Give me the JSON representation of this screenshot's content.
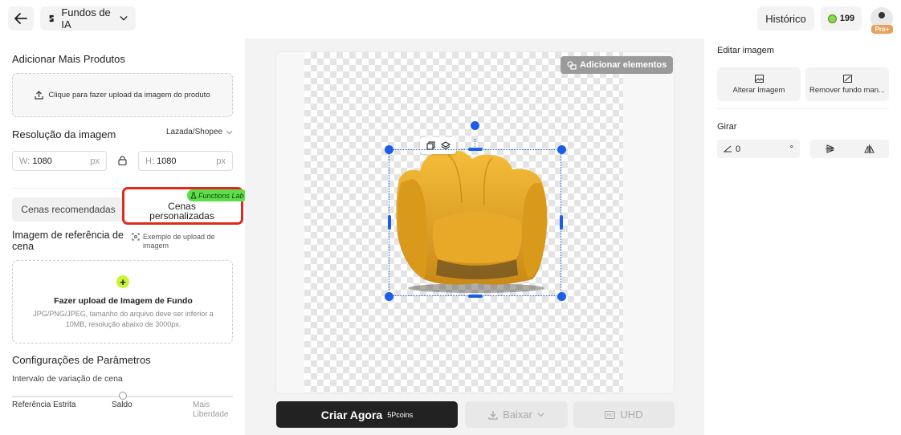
{
  "header": {
    "tool_label": "Fundos de IA",
    "history_label": "Histórico",
    "coins": "199",
    "pro_badge": "Pro+"
  },
  "left": {
    "add_products_title": "Adicionar Mais Produtos",
    "upload_product_label": "Clique para fazer upload da imagem do produto",
    "resolution_title": "Resolução da imagem",
    "resolution_preset": "Lazada/Shopee",
    "width_label": "W:",
    "width_value": "1080",
    "height_label": "H:",
    "height_value": "1080",
    "unit": "px",
    "tab_recommended": "Cenas recomendadas",
    "tab_custom": "Cenas personalizadas",
    "lab_badge": "Functions Lab",
    "reference_title": "Imagem de referência de cena",
    "reference_example": "Exemplo de upload de imagem",
    "upload_bg_title": "Fazer upload de Imagem de Fundo",
    "upload_bg_desc": "JPG/PNG/JPEG, tamanho do arquivo deve ser inferior a 10MB, resolução abaixo de 3000px.",
    "params_title": "Configurações de Parâmetros",
    "variation_label": "Intervalo de variação de cena",
    "slider_value": 0.5,
    "slider_left": "Referência Estrita",
    "slider_mid": "Saldo",
    "slider_right": "Mais Liberdade"
  },
  "center": {
    "add_elements_label": "Adicionar elementos",
    "create_label": "Criar Agora",
    "create_cost": "5Pcoins",
    "download_label": "Baixar",
    "uhd_label": "UHD"
  },
  "right": {
    "edit_title": "Editar imagem",
    "alter_label": "Alterar Imagem",
    "remove_label": "Remover fundo man...",
    "rotate_title": "Girar",
    "rotate_value": "0",
    "rotate_unit": "°"
  },
  "colors": {
    "accent_blue": "#1a5ee8",
    "highlight_red": "#e02a1b",
    "lab_green": "#5ce04a",
    "plus_lime": "#c8f53a"
  }
}
